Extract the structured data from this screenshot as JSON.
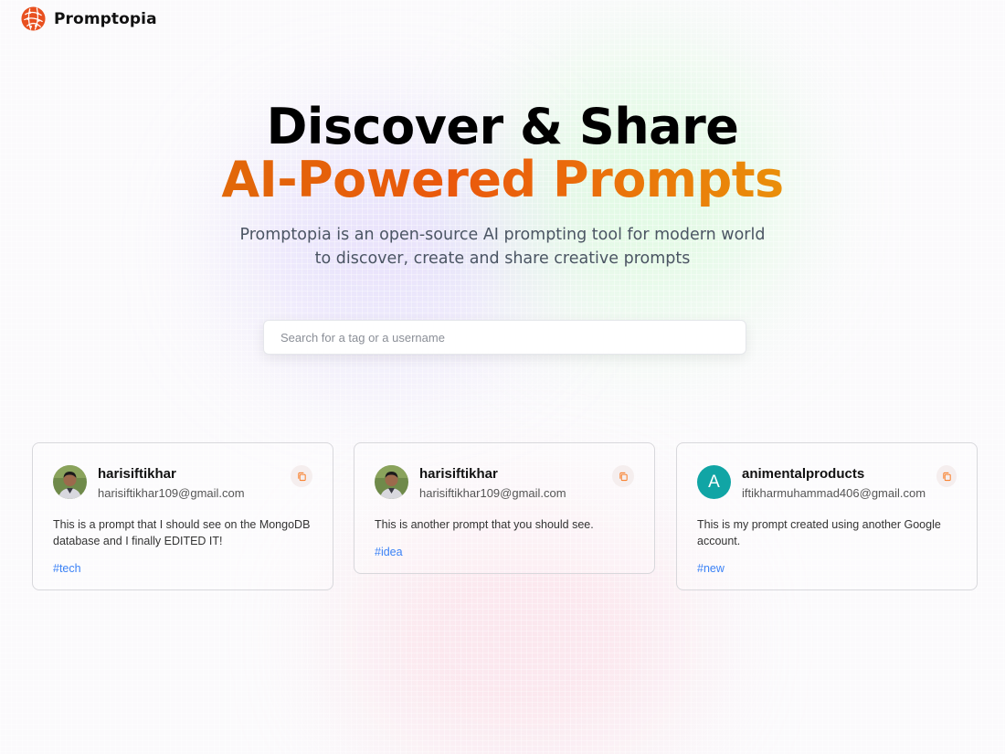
{
  "nav": {
    "brand": "Promptopia",
    "logo_icon": "globe-logo-icon"
  },
  "hero": {
    "heading_line_1": "Discover & Share",
    "heading_line_2": "AI-Powered Prompts",
    "description": "Promptopia is an open-source AI prompting tool for modern world to discover, create and share creative prompts",
    "gradient_colors": [
      "#d97706",
      "#ea580c",
      "#eab308"
    ]
  },
  "search": {
    "placeholder": "Search for a tag or a username",
    "value": ""
  },
  "cards": [
    {
      "username": "harisiftikhar",
      "email": "harisiftikhar109@gmail.com",
      "prompt": "This is a prompt that I should see on the MongoDB database and I finally EDITED IT!",
      "tag": "#tech",
      "avatar": "photo"
    },
    {
      "username": "harisiftikhar",
      "email": "harisiftikhar109@gmail.com",
      "prompt": "This is another prompt that you should see.",
      "tag": "#idea",
      "avatar": "photo"
    },
    {
      "username": "animentalproducts",
      "email": "iftikharmuhammad406@gmail.com",
      "prompt": "This is my prompt created using another Google account.",
      "tag": "#new",
      "avatar_letter": "A",
      "avatar_color": "#11a5a5"
    }
  ],
  "colors": {
    "tag": "#3b82f6",
    "copy_icon": "#f97316",
    "logo": "#e8501f"
  }
}
